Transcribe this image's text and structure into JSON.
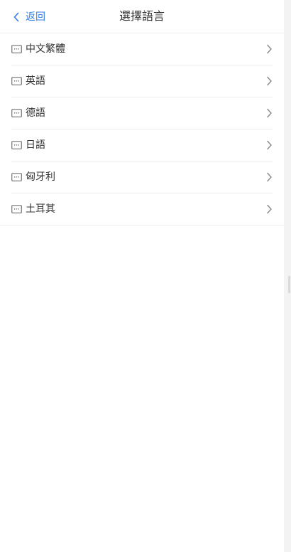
{
  "header": {
    "back_label": "返回",
    "title": "選擇語言"
  },
  "languages": [
    {
      "label": "中文繁體",
      "icon": "message-icon"
    },
    {
      "label": "英語",
      "icon": "message-icon"
    },
    {
      "label": "德語",
      "icon": "message-icon"
    },
    {
      "label": "日語",
      "icon": "message-icon"
    },
    {
      "label": "匈牙利",
      "icon": "message-icon"
    },
    {
      "label": "土耳其",
      "icon": "message-icon"
    }
  ],
  "colors": {
    "accent": "#2f7ee6",
    "text": "#333333",
    "icon": "#666666",
    "divider": "#eeeeee",
    "background": "#ffffff"
  }
}
